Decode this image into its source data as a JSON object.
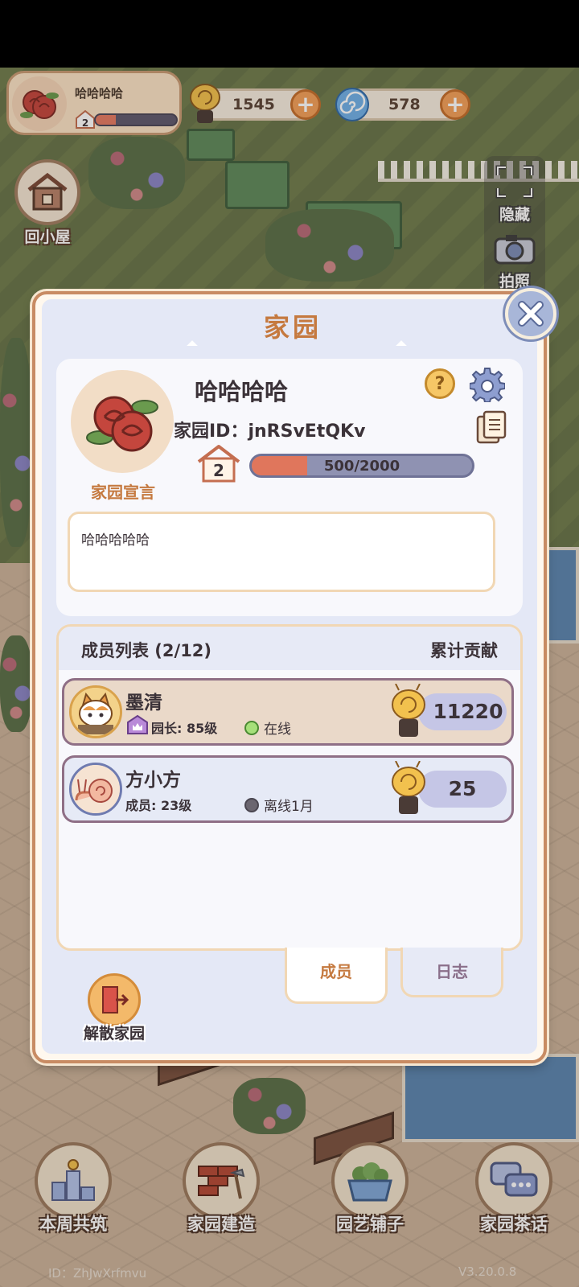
{
  "player": {
    "name": "哈哈哈哈",
    "level": "2",
    "exp_progress": 0.25
  },
  "currency": {
    "snail_coins": "1545",
    "spiral_gems": "578"
  },
  "side_buttons": {
    "home_label": "回小屋"
  },
  "right_tools": {
    "hide_label": "隐藏",
    "photo_label": "拍照"
  },
  "modal": {
    "title": "家园",
    "home_name": "哈哈哈哈",
    "home_id_label": "家园ID：",
    "home_id": "jnRSvEtQKv",
    "help_glyph": "?",
    "level": "2",
    "exp_text": "500/2000",
    "exp_progress": 0.25,
    "declaration_label": "家园宣言",
    "declaration_text": "哈哈哈哈哈",
    "members_title": "成员列表 (2/12)",
    "contribution_title": "累计贡献",
    "members": [
      {
        "name": "墨清",
        "role": "园长: 85级",
        "status": "在线",
        "online": true,
        "contribution": "11220"
      },
      {
        "name": "方小方",
        "role": "成员: 23级",
        "status": "离线1月",
        "online": false,
        "contribution": "25"
      }
    ],
    "tabs": {
      "members": "成员",
      "log": "日志"
    },
    "dissolve_label": "解散家园"
  },
  "bottom_nav": [
    {
      "label": "本周共筑",
      "icon": "podium-icon"
    },
    {
      "label": "家园建造",
      "icon": "bricks-icon"
    },
    {
      "label": "园艺铺子",
      "icon": "flower-basket-icon"
    },
    {
      "label": "家园茶话",
      "icon": "chat-bubbles-icon"
    }
  ],
  "footer": {
    "id_text": "ID：ZhJwXrfmvu",
    "version": "V3.20.0.8"
  },
  "colors": {
    "accent": "#c5793f",
    "panel": "#e4e8f6",
    "exp_fill": "#e0765c"
  }
}
